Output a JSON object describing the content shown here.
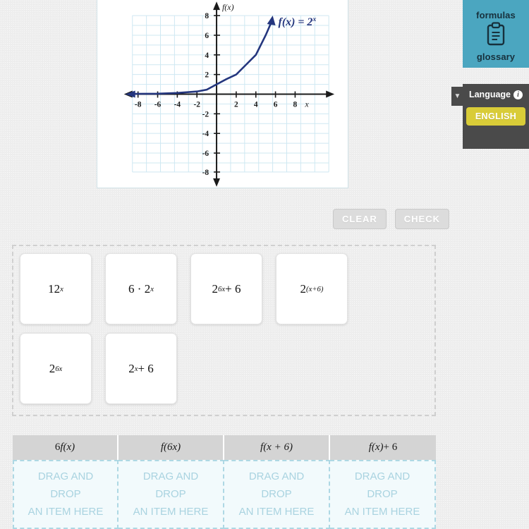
{
  "graph": {
    "curve_label": "f(x) = 2",
    "curve_label_exponent": "x",
    "y_axis_label": "f(x)",
    "x_axis_label": "x",
    "x_ticks": [
      "-8",
      "-6",
      "-4",
      "-2",
      "2",
      "4",
      "6",
      "8"
    ],
    "y_ticks": [
      "8",
      "6",
      "4",
      "2",
      "-2",
      "-4",
      "-6",
      "-8"
    ],
    "curve_color": "#24367e",
    "grid_color": "#cfe8f2",
    "function": "2^x"
  },
  "sidebar": {
    "formulas_label": "formulas",
    "glossary_label": "glossary",
    "glossary_icon": "clipboard-icon",
    "panel_color": "#4ba6c0",
    "language": {
      "title": "Language",
      "info_icon": "info-icon",
      "selected": "ENGLISH",
      "collapse_icon": "▼",
      "panel_color": "#4a4a4a",
      "button_color": "#d9cc38"
    }
  },
  "actions": {
    "clear_label": "CLEAR",
    "check_label": "CHECK"
  },
  "tiles": [
    [
      {
        "base": "12",
        "exp": "x",
        "exp_italic": true,
        "suffix": ""
      },
      {
        "base": "6 · 2",
        "exp": "x",
        "exp_italic": true,
        "suffix": ""
      },
      {
        "base": "2",
        "exp": "6x",
        "exp_italic": true,
        "suffix": " + 6"
      },
      {
        "base": "2",
        "exp": "(x+6)",
        "exp_italic": true,
        "suffix": ""
      }
    ],
    [
      {
        "base": "2",
        "exp": "6x",
        "exp_italic": true,
        "suffix": ""
      },
      {
        "base": "2",
        "exp": "x",
        "exp_italic": true,
        "suffix": " + 6"
      }
    ]
  ],
  "drop_columns": [
    {
      "header_prefix": "6",
      "header_fn": "f",
      "header_arg": "(x)",
      "header_suffix": "",
      "placeholder": "DRAG AND\nDROP\nAN ITEM HERE"
    },
    {
      "header_prefix": "",
      "header_fn": "f",
      "header_arg": "(6x)",
      "header_suffix": "",
      "placeholder": "DRAG AND\nDROP\nAN ITEM HERE"
    },
    {
      "header_prefix": "",
      "header_fn": "f",
      "header_arg": "(x + 6)",
      "header_suffix": "",
      "placeholder": "DRAG AND\nDROP\nAN ITEM HERE"
    },
    {
      "header_prefix": "",
      "header_fn": "f",
      "header_arg": "(x)",
      "header_suffix": " + 6",
      "placeholder": "DRAG AND\nDROP\nAN ITEM HERE"
    }
  ]
}
